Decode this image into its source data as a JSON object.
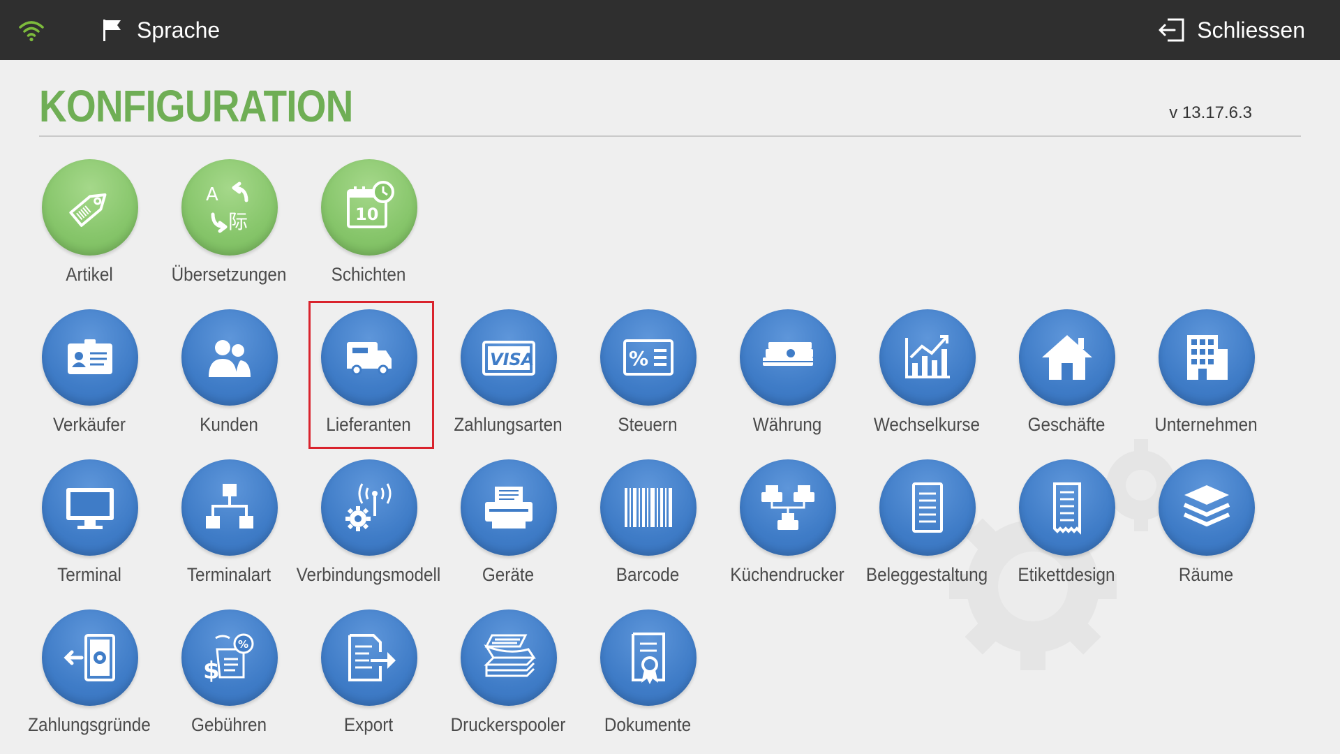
{
  "topbar": {
    "language_label": "Sprache",
    "close_label": "Schliessen"
  },
  "header": {
    "title": "KONFIGURATION",
    "version": "v 13.17.6.3"
  },
  "colors": {
    "accent_green": "#6fae55",
    "icon_blue": "#3f7cc7",
    "icon_green": "#86c56a",
    "highlight_red": "#d9232d",
    "topbar_bg": "#2f2f2f"
  },
  "rows": [
    [
      {
        "label": "Artikel",
        "icon": "tag-icon",
        "color": "green"
      },
      {
        "label": "Übersetzungen",
        "icon": "translate-icon",
        "color": "green"
      },
      {
        "label": "Schichten",
        "icon": "calendar-clock-icon",
        "color": "green"
      }
    ],
    [
      {
        "label": "Verkäufer",
        "icon": "id-card-icon",
        "color": "blue"
      },
      {
        "label": "Kunden",
        "icon": "users-icon",
        "color": "blue"
      },
      {
        "label": "Lieferanten",
        "icon": "truck-icon",
        "color": "blue",
        "selected": true
      },
      {
        "label": "Zahlungsarten",
        "icon": "visa-card-icon",
        "color": "blue"
      },
      {
        "label": "Steuern",
        "icon": "percent-icon",
        "color": "blue"
      },
      {
        "label": "Währung",
        "icon": "money-stack-icon",
        "color": "blue"
      },
      {
        "label": "Wechselkurse",
        "icon": "chart-up-icon",
        "color": "blue"
      },
      {
        "label": "Geschäfte",
        "icon": "home-icon",
        "color": "blue"
      },
      {
        "label": "Unternehmen",
        "icon": "building-icon",
        "color": "blue"
      }
    ],
    [
      {
        "label": "Terminal",
        "icon": "monitor-icon",
        "color": "blue"
      },
      {
        "label": "Terminalart",
        "icon": "network-tree-icon",
        "color": "blue"
      },
      {
        "label": "Verbindungsmodell",
        "icon": "antenna-gear-icon",
        "color": "blue"
      },
      {
        "label": "Geräte",
        "icon": "printer-icon",
        "color": "blue"
      },
      {
        "label": "Barcode",
        "icon": "barcode-icon",
        "color": "blue"
      },
      {
        "label": "Küchendrucker",
        "icon": "printers-network-icon",
        "color": "blue"
      },
      {
        "label": "Beleggestaltung",
        "icon": "document-lines-icon",
        "color": "blue"
      },
      {
        "label": "Etikettdesign",
        "icon": "receipt-icon",
        "color": "blue"
      },
      {
        "label": "Räume",
        "icon": "layers-icon",
        "color": "blue"
      }
    ],
    [
      {
        "label": "Zahlungsgründe",
        "icon": "cash-in-icon",
        "color": "blue"
      },
      {
        "label": "Gebühren",
        "icon": "fees-icon",
        "color": "blue"
      },
      {
        "label": "Export",
        "icon": "export-icon",
        "color": "blue"
      },
      {
        "label": "Druckerspooler",
        "icon": "paper-stack-icon",
        "color": "blue"
      },
      {
        "label": "Dokumente",
        "icon": "certificate-icon",
        "color": "blue"
      }
    ]
  ]
}
